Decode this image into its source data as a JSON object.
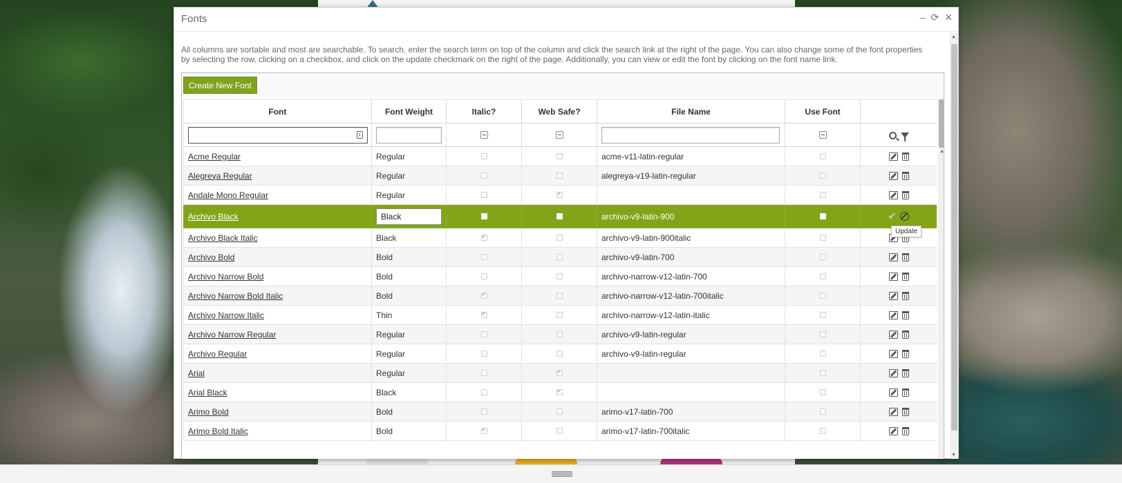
{
  "dialog": {
    "title": "Fonts",
    "description": "All columns are sortable and most are searchable. To search, enter the search term on top of the column and click the search link at the right of the page. You can also change some of the font properties by selecting the row, clicking on a checkbox, and click on the update checkmark on the right of the page. Additionally, you can view or edit the font by clicking on the font name link.",
    "create_button": "Create New Font",
    "controls": [
      "–",
      "⟳",
      "✕"
    ]
  },
  "columns": [
    "Font",
    "Font Weight",
    "Italic?",
    "Web Safe?",
    "File Name",
    "Use Font",
    ""
  ],
  "rows": [
    {
      "font": "Acme Regular",
      "weight": "Regular",
      "italic": false,
      "websafe": false,
      "file": "acme-v11-latin-regular",
      "use": false
    },
    {
      "font": "Alegreya Regular",
      "weight": "Regular",
      "italic": false,
      "websafe": false,
      "file": "alegreya-v19-latin-regular",
      "use": false
    },
    {
      "font": "Andale Mono Regular",
      "weight": "Regular",
      "italic": false,
      "websafe": true,
      "file": "",
      "use": false
    },
    {
      "font": "Archivo Black",
      "weight": "Black",
      "italic": false,
      "websafe": false,
      "file": "archivo-v9-latin-900",
      "use": false,
      "selected": true
    },
    {
      "font": "Archivo Black Italic",
      "weight": "Black",
      "italic": true,
      "websafe": false,
      "file": "archivo-v9-latin-900italic",
      "use": false
    },
    {
      "font": "Archivo Bold",
      "weight": "Bold",
      "italic": false,
      "websafe": false,
      "file": "archivo-v9-latin-700",
      "use": false
    },
    {
      "font": "Archivo Narrow Bold",
      "weight": "Bold",
      "italic": false,
      "websafe": false,
      "file": "archivo-narrow-v12-latin-700",
      "use": false
    },
    {
      "font": "Archivo Narrow Bold Italic",
      "weight": "Bold",
      "italic": true,
      "websafe": false,
      "file": "archivo-narrow-v12-latin-700italic",
      "use": false
    },
    {
      "font": "Archivo Narrow Italic",
      "weight": "Thin",
      "italic": true,
      "websafe": false,
      "file": "archivo-narrow-v12-latin-italic",
      "use": false
    },
    {
      "font": "Archivo Narrow Regular",
      "weight": "Regular",
      "italic": false,
      "websafe": false,
      "file": "archivo-v9-latin-regular",
      "use": false
    },
    {
      "font": "Archivo Regular",
      "weight": "Regular",
      "italic": false,
      "websafe": false,
      "file": "archivo-v9-latin-regular",
      "use": false
    },
    {
      "font": "Arial",
      "weight": "Regular",
      "italic": false,
      "websafe": true,
      "file": "",
      "use": false
    },
    {
      "font": "Arial Black",
      "weight": "Black",
      "italic": false,
      "websafe": true,
      "file": "",
      "use": false
    },
    {
      "font": "Arimo Bold",
      "weight": "Bold",
      "italic": false,
      "websafe": false,
      "file": "arimo-v17-latin-700",
      "use": false
    },
    {
      "font": "Arimo Bold Italic",
      "weight": "Bold",
      "italic": true,
      "websafe": false,
      "file": "arimo-v17-latin-700italic",
      "use": false
    }
  ],
  "tooltip": "Update",
  "colors": {
    "accent": "#83a418",
    "button": "#7fa320"
  },
  "icons": [
    "edit-icon",
    "trash-icon",
    "search-icon",
    "filter-icon",
    "checkmark-icon",
    "cancel-icon"
  ]
}
